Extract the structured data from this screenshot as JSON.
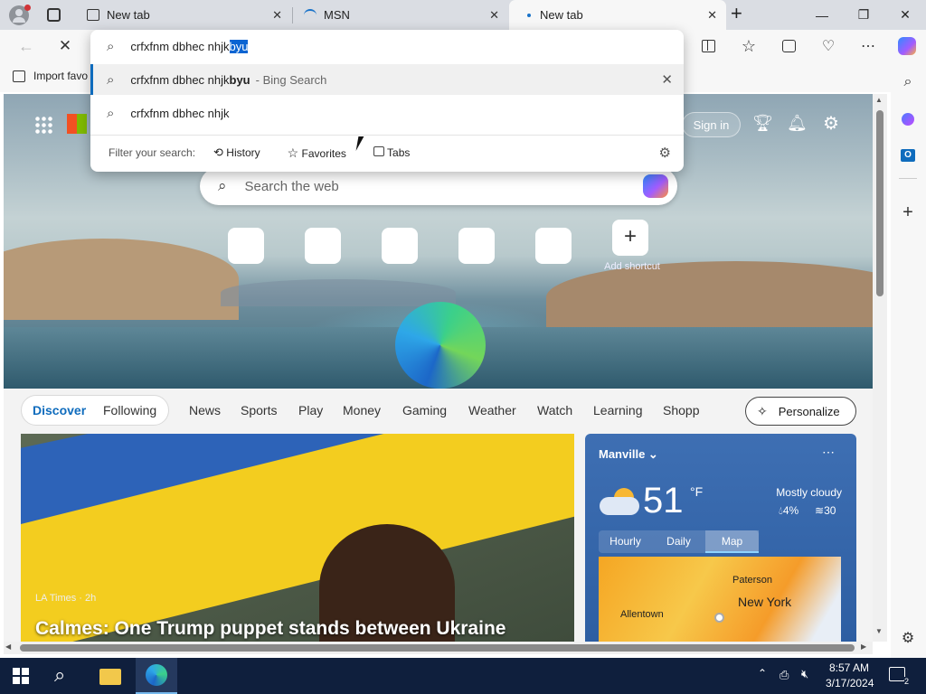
{
  "tabs": [
    {
      "title": "New tab",
      "icon": "newtab-icon"
    },
    {
      "title": "MSN",
      "icon": "msn-icon"
    },
    {
      "title": "New tab",
      "icon": "loading-icon",
      "active": true
    }
  ],
  "address": {
    "typed": "crfxfnm dbhec nhjk",
    "selected_completion": "byu"
  },
  "dropdown": {
    "suggestions": [
      {
        "query": "crfxfnm dbhec nhjk",
        "bold": "byu",
        "suffix": "- Bing Search"
      },
      {
        "query": "crfxfnm dbhec nhjk"
      }
    ],
    "filter_label": "Filter your search:",
    "filters": [
      "History",
      "Favorites",
      "Tabs"
    ]
  },
  "favbar": {
    "import": "Import favo"
  },
  "ntp": {
    "signin": "Sign in",
    "search_placeholder": "Search the web",
    "add_shortcut": "Add shortcut",
    "feed_tabs": [
      "Discover",
      "Following",
      "News",
      "Sports",
      "Play",
      "Money",
      "Gaming",
      "Weather",
      "Watch",
      "Learning",
      "Shopp"
    ],
    "personalize": "Personalize",
    "article": {
      "source": "LA Times · 2h",
      "headline": "Calmes: One Trump puppet stands between Ukraine"
    },
    "weather": {
      "location": "Manville",
      "temp": "51",
      "unit": "°F",
      "condition": "Mostly cloudy",
      "precip": "4%",
      "wind": "30",
      "tabs": [
        "Hourly",
        "Daily",
        "Map"
      ],
      "map_labels": [
        "Paterson",
        "New York",
        "Allentown"
      ]
    }
  },
  "taskbar": {
    "time": "8:57 AM",
    "date": "3/17/2024",
    "notifications": "2"
  },
  "colors": {
    "accent": "#0f6cbd",
    "taskbar": "#0f1f3d",
    "highlight": "#0a64d2"
  }
}
